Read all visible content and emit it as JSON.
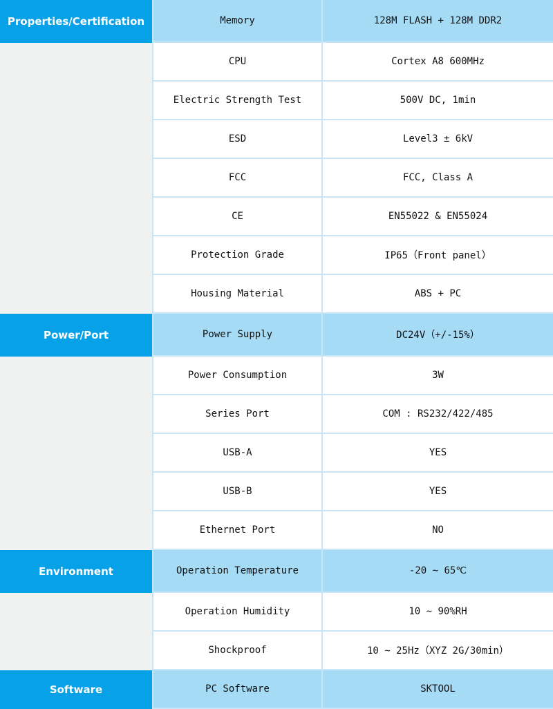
{
  "colors": {
    "section": "#07a1e8",
    "section_row": "#a6dbf5",
    "side": "#f0f1f1",
    "border": "#c8e6f7"
  },
  "sections": [
    {
      "label": "Properties/Certification",
      "rows": [
        [
          "Memory",
          "128M FLASH + 128M DDR2"
        ],
        [
          "CPU",
          "Cortex A8 600MHz"
        ],
        [
          "Electric Strength Test",
          "500V DC, 1min"
        ],
        [
          "ESD",
          "Level3 ± 6kV"
        ],
        [
          "FCC",
          "FCC, Class A"
        ],
        [
          "CE",
          "EN55022 & EN55024"
        ],
        [
          "Protection Grade",
          "IP65（Front panel）"
        ],
        [
          "Housing Material",
          "ABS + PC"
        ]
      ]
    },
    {
      "label": "Power/Port",
      "rows": [
        [
          "Power Supply",
          "DC24V（+/-15%）"
        ],
        [
          "Power Consumption",
          "3W"
        ],
        [
          "Series Port",
          "COM : RS232/422/485"
        ],
        [
          "USB-A",
          "YES"
        ],
        [
          "USB-B",
          "YES"
        ],
        [
          "Ethernet Port",
          "NO"
        ]
      ]
    },
    {
      "label": "Environment",
      "rows": [
        [
          "Operation Temperature",
          "-20 ~ 65℃"
        ],
        [
          "Operation Humidity",
          "10 ~ 90%RH"
        ],
        [
          "Shockproof",
          "10 ~ 25Hz（XYZ 2G/30min）"
        ]
      ]
    },
    {
      "label": "Software",
      "rows": [
        [
          "PC Software",
          "SKTOOL"
        ]
      ]
    }
  ]
}
